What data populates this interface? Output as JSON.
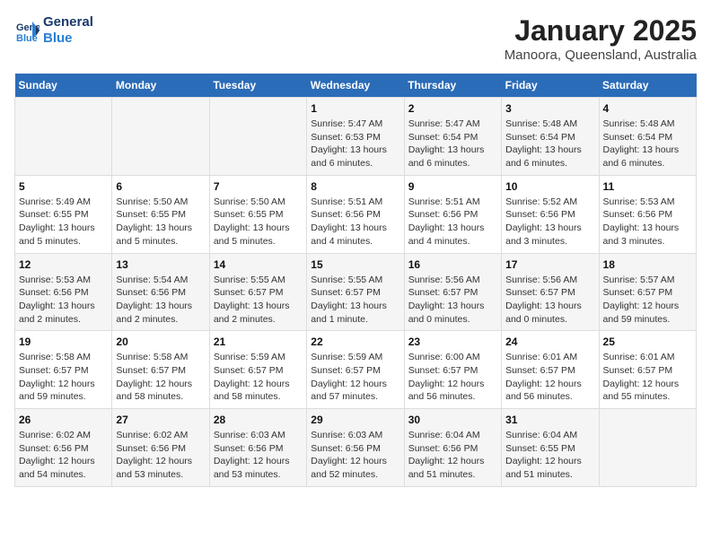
{
  "header": {
    "logo_line1": "General",
    "logo_line2": "Blue",
    "month_year": "January 2025",
    "location": "Manoora, Queensland, Australia"
  },
  "weekdays": [
    "Sunday",
    "Monday",
    "Tuesday",
    "Wednesday",
    "Thursday",
    "Friday",
    "Saturday"
  ],
  "weeks": [
    [
      {
        "day": "",
        "info": ""
      },
      {
        "day": "",
        "info": ""
      },
      {
        "day": "",
        "info": ""
      },
      {
        "day": "1",
        "info": "Sunrise: 5:47 AM\nSunset: 6:53 PM\nDaylight: 13 hours and 6 minutes."
      },
      {
        "day": "2",
        "info": "Sunrise: 5:47 AM\nSunset: 6:54 PM\nDaylight: 13 hours and 6 minutes."
      },
      {
        "day": "3",
        "info": "Sunrise: 5:48 AM\nSunset: 6:54 PM\nDaylight: 13 hours and 6 minutes."
      },
      {
        "day": "4",
        "info": "Sunrise: 5:48 AM\nSunset: 6:54 PM\nDaylight: 13 hours and 6 minutes."
      }
    ],
    [
      {
        "day": "5",
        "info": "Sunrise: 5:49 AM\nSunset: 6:55 PM\nDaylight: 13 hours and 5 minutes."
      },
      {
        "day": "6",
        "info": "Sunrise: 5:50 AM\nSunset: 6:55 PM\nDaylight: 13 hours and 5 minutes."
      },
      {
        "day": "7",
        "info": "Sunrise: 5:50 AM\nSunset: 6:55 PM\nDaylight: 13 hours and 5 minutes."
      },
      {
        "day": "8",
        "info": "Sunrise: 5:51 AM\nSunset: 6:56 PM\nDaylight: 13 hours and 4 minutes."
      },
      {
        "day": "9",
        "info": "Sunrise: 5:51 AM\nSunset: 6:56 PM\nDaylight: 13 hours and 4 minutes."
      },
      {
        "day": "10",
        "info": "Sunrise: 5:52 AM\nSunset: 6:56 PM\nDaylight: 13 hours and 3 minutes."
      },
      {
        "day": "11",
        "info": "Sunrise: 5:53 AM\nSunset: 6:56 PM\nDaylight: 13 hours and 3 minutes."
      }
    ],
    [
      {
        "day": "12",
        "info": "Sunrise: 5:53 AM\nSunset: 6:56 PM\nDaylight: 13 hours and 2 minutes."
      },
      {
        "day": "13",
        "info": "Sunrise: 5:54 AM\nSunset: 6:56 PM\nDaylight: 13 hours and 2 minutes."
      },
      {
        "day": "14",
        "info": "Sunrise: 5:55 AM\nSunset: 6:57 PM\nDaylight: 13 hours and 2 minutes."
      },
      {
        "day": "15",
        "info": "Sunrise: 5:55 AM\nSunset: 6:57 PM\nDaylight: 13 hours and 1 minute."
      },
      {
        "day": "16",
        "info": "Sunrise: 5:56 AM\nSunset: 6:57 PM\nDaylight: 13 hours and 0 minutes."
      },
      {
        "day": "17",
        "info": "Sunrise: 5:56 AM\nSunset: 6:57 PM\nDaylight: 13 hours and 0 minutes."
      },
      {
        "day": "18",
        "info": "Sunrise: 5:57 AM\nSunset: 6:57 PM\nDaylight: 12 hours and 59 minutes."
      }
    ],
    [
      {
        "day": "19",
        "info": "Sunrise: 5:58 AM\nSunset: 6:57 PM\nDaylight: 12 hours and 59 minutes."
      },
      {
        "day": "20",
        "info": "Sunrise: 5:58 AM\nSunset: 6:57 PM\nDaylight: 12 hours and 58 minutes."
      },
      {
        "day": "21",
        "info": "Sunrise: 5:59 AM\nSunset: 6:57 PM\nDaylight: 12 hours and 58 minutes."
      },
      {
        "day": "22",
        "info": "Sunrise: 5:59 AM\nSunset: 6:57 PM\nDaylight: 12 hours and 57 minutes."
      },
      {
        "day": "23",
        "info": "Sunrise: 6:00 AM\nSunset: 6:57 PM\nDaylight: 12 hours and 56 minutes."
      },
      {
        "day": "24",
        "info": "Sunrise: 6:01 AM\nSunset: 6:57 PM\nDaylight: 12 hours and 56 minutes."
      },
      {
        "day": "25",
        "info": "Sunrise: 6:01 AM\nSunset: 6:57 PM\nDaylight: 12 hours and 55 minutes."
      }
    ],
    [
      {
        "day": "26",
        "info": "Sunrise: 6:02 AM\nSunset: 6:56 PM\nDaylight: 12 hours and 54 minutes."
      },
      {
        "day": "27",
        "info": "Sunrise: 6:02 AM\nSunset: 6:56 PM\nDaylight: 12 hours and 53 minutes."
      },
      {
        "day": "28",
        "info": "Sunrise: 6:03 AM\nSunset: 6:56 PM\nDaylight: 12 hours and 53 minutes."
      },
      {
        "day": "29",
        "info": "Sunrise: 6:03 AM\nSunset: 6:56 PM\nDaylight: 12 hours and 52 minutes."
      },
      {
        "day": "30",
        "info": "Sunrise: 6:04 AM\nSunset: 6:56 PM\nDaylight: 12 hours and 51 minutes."
      },
      {
        "day": "31",
        "info": "Sunrise: 6:04 AM\nSunset: 6:55 PM\nDaylight: 12 hours and 51 minutes."
      },
      {
        "day": "",
        "info": ""
      }
    ]
  ]
}
